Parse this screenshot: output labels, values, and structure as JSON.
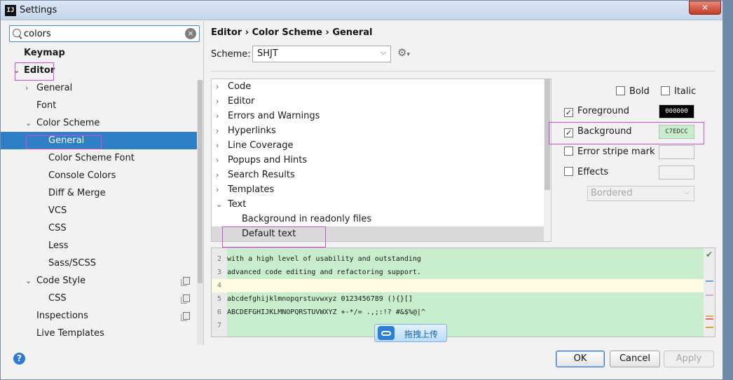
{
  "window": {
    "title": "Settings",
    "app_icon": "IJ",
    "close_glyph": "✕"
  },
  "search": {
    "value": "colors"
  },
  "sidebar": {
    "items": [
      {
        "label": "Keymap",
        "indent": 0,
        "arrow": "",
        "bold": true
      },
      {
        "label": "Editor",
        "indent": 0,
        "arrow": "⌄",
        "bold": true
      },
      {
        "label": "General",
        "indent": 1,
        "arrow": "›"
      },
      {
        "label": "Font",
        "indent": 1,
        "arrow": ""
      },
      {
        "label": "Color Scheme",
        "indent": 1,
        "arrow": "⌄"
      },
      {
        "label": "General",
        "indent": 2,
        "arrow": "",
        "selected": true
      },
      {
        "label": "Color Scheme Font",
        "indent": 2,
        "arrow": ""
      },
      {
        "label": "Console Colors",
        "indent": 2,
        "arrow": ""
      },
      {
        "label": "Diff & Merge",
        "indent": 2,
        "arrow": ""
      },
      {
        "label": "VCS",
        "indent": 2,
        "arrow": ""
      },
      {
        "label": "CSS",
        "indent": 2,
        "arrow": ""
      },
      {
        "label": "Less",
        "indent": 2,
        "arrow": ""
      },
      {
        "label": "Sass/SCSS",
        "indent": 2,
        "arrow": ""
      },
      {
        "label": "Code Style",
        "indent": 1,
        "arrow": "⌄",
        "copy": true
      },
      {
        "label": "CSS",
        "indent": 2,
        "arrow": "",
        "copy": true
      },
      {
        "label": "Inspections",
        "indent": 1,
        "arrow": "",
        "copy": true
      },
      {
        "label": "Live Templates",
        "indent": 1,
        "arrow": ""
      }
    ]
  },
  "breadcrumb": {
    "text": "Editor › Color Scheme › General"
  },
  "scheme": {
    "label": "Scheme:",
    "value": "SHJT"
  },
  "attributes_tree": {
    "items": [
      {
        "label": "Code",
        "arrow": "›",
        "indent": 0
      },
      {
        "label": "Editor",
        "arrow": "›",
        "indent": 0
      },
      {
        "label": "Errors and Warnings",
        "arrow": "›",
        "indent": 0
      },
      {
        "label": "Hyperlinks",
        "arrow": "›",
        "indent": 0
      },
      {
        "label": "Line Coverage",
        "arrow": "›",
        "indent": 0
      },
      {
        "label": "Popups and Hints",
        "arrow": "›",
        "indent": 0
      },
      {
        "label": "Search Results",
        "arrow": "›",
        "indent": 0
      },
      {
        "label": "Templates",
        "arrow": "›",
        "indent": 0
      },
      {
        "label": "Text",
        "arrow": "⌄",
        "indent": 0
      },
      {
        "label": "Background in readonly files",
        "arrow": "",
        "indent": 1
      },
      {
        "label": "Default text",
        "arrow": "",
        "indent": 1,
        "selected": true
      }
    ]
  },
  "options": {
    "bold": {
      "label": "Bold",
      "checked": false
    },
    "italic": {
      "label": "Italic",
      "checked": false
    },
    "foreground": {
      "label": "Foreground",
      "checked": true,
      "color_text": "000000",
      "color": "#000000"
    },
    "background": {
      "label": "Background",
      "checked": true,
      "color_text": "C7EDCC",
      "color": "#c7edcc"
    },
    "error_stripe": {
      "label": "Error stripe mark",
      "checked": false
    },
    "effects": {
      "label": "Effects",
      "checked": false,
      "type_value": "Bordered"
    }
  },
  "preview": {
    "lines": [
      {
        "no": "2",
        "text": "with a high level of usability and outstanding"
      },
      {
        "no": "3",
        "text": "advanced code editing and refactoring support."
      },
      {
        "no": "4",
        "text": "",
        "current": true
      },
      {
        "no": "5",
        "text": "abcdefghijklmnopqrstuvwxyz 0123456789 (){}[]"
      },
      {
        "no": "6",
        "text": "ABCDEFGHIJKLMNOPQRSTUVWXYZ +-*/= .,;:!? #&$%@|^"
      },
      {
        "no": "7",
        "text": ""
      }
    ]
  },
  "upload": {
    "label": "拖拽上传"
  },
  "buttons": {
    "ok": "OK",
    "cancel": "Cancel",
    "apply": "Apply"
  },
  "colors": {
    "selection": "#2f7fc6",
    "highlight": "#d04ae0",
    "preview_bg": "#c7edcc"
  }
}
